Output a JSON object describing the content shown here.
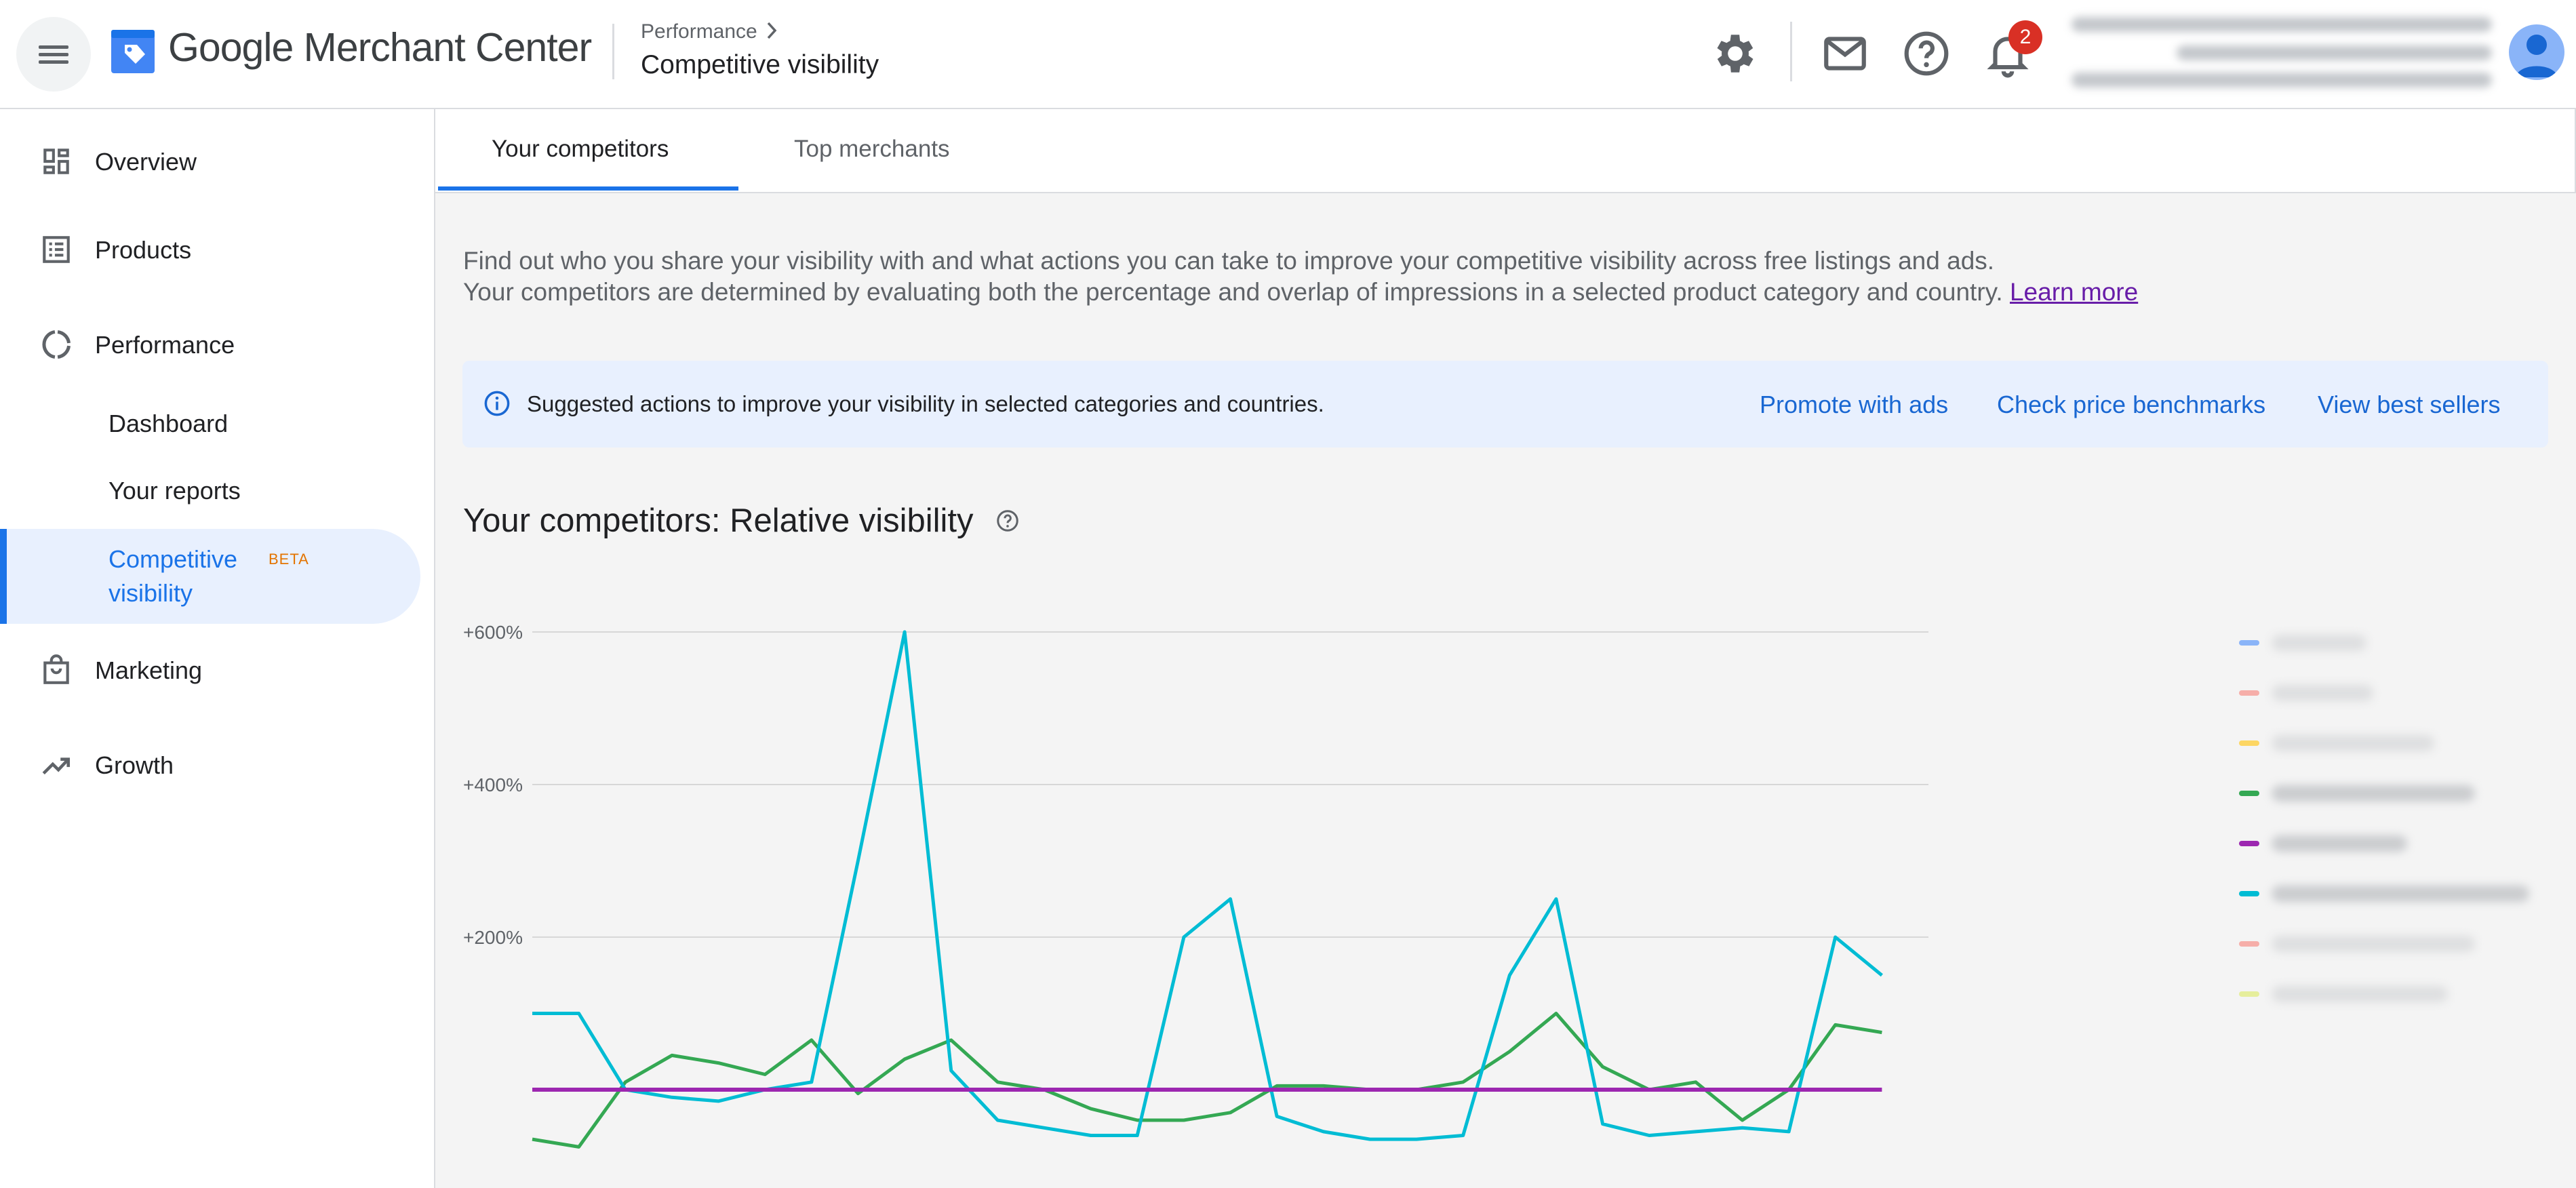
{
  "header": {
    "app_name_google": "Google",
    "app_name_rest": "Merchant Center",
    "breadcrumb_parent": "Performance",
    "page_title": "Competitive visibility",
    "notification_count": "2",
    "icons": [
      "settings-gear-icon",
      "mail-icon",
      "help-circle-icon",
      "bell-icon"
    ]
  },
  "sidebar": {
    "items": [
      {
        "label": "Overview",
        "icon": "dashboard-icon"
      },
      {
        "label": "Products",
        "icon": "list-icon"
      },
      {
        "label": "Performance",
        "icon": "donut-chart-icon"
      },
      {
        "label": "Marketing",
        "icon": "shopping-bag-icon"
      },
      {
        "label": "Growth",
        "icon": "trending-up-icon"
      }
    ],
    "performance_sub": [
      "Dashboard",
      "Your reports"
    ],
    "active_label": "Competitive visibility",
    "active_badge": "BETA",
    "accent": "#1a73e8",
    "active_bg": "#e8f0fe"
  },
  "tabs": [
    {
      "label": "Your competitors",
      "selected": true
    },
    {
      "label": "Top merchants",
      "selected": false
    }
  ],
  "intro": {
    "line1": "Find out who you share your visibility with and what actions you can take to improve your competitive visibility across free listings and ads.",
    "line2": "Your competitors are determined by evaluating both the percentage and overlap of impressions in a selected product category and country.",
    "learn_more": "Learn more"
  },
  "banner": {
    "text": "Suggested actions to improve your visibility in selected categories and countries.",
    "actions": [
      "Promote with ads",
      "Check price benchmarks",
      "View best sellers"
    ]
  },
  "chart_section": {
    "title": "Your competitors: Relative visibility"
  },
  "chart_data": {
    "type": "line",
    "title": "Your competitors: Relative visibility",
    "y_tick_labels": [
      "+600%",
      "+400%",
      "+200%"
    ],
    "y_ticks": [
      600,
      400,
      200
    ],
    "ylim": [
      -130,
      600
    ],
    "x": [
      0,
      1,
      2,
      3,
      4,
      5,
      6,
      7,
      8,
      9,
      10,
      11,
      12,
      13,
      14,
      15,
      16,
      17,
      18,
      19,
      20,
      21,
      22,
      23,
      24,
      25,
      26,
      27,
      28,
      29,
      30
    ],
    "grid": true,
    "legend_position": "right",
    "series": [
      {
        "color": "#00bcd4",
        "values": [
          100,
          100,
          0,
          -10,
          -15,
          0,
          10,
          300,
          600,
          25,
          -40,
          -50,
          -60,
          -60,
          200,
          250,
          -35,
          -55,
          -65,
          -65,
          -60,
          150,
          250,
          -45,
          -60,
          -55,
          -50,
          -55,
          200,
          150,
          null
        ]
      },
      {
        "color": "#34a853",
        "values": [
          -65,
          -75,
          10,
          45,
          35,
          20,
          65,
          -5,
          40,
          65,
          10,
          0,
          -25,
          -40,
          -40,
          -30,
          5,
          5,
          0,
          0,
          10,
          50,
          100,
          30,
          0,
          10,
          -40,
          0,
          85,
          75,
          null
        ]
      },
      {
        "color": "#9c27b0",
        "values": [
          0,
          0,
          0,
          0,
          0,
          0,
          0,
          0,
          0,
          0,
          0,
          0,
          0,
          0,
          0,
          0,
          0,
          0,
          0,
          0,
          0,
          0,
          0,
          0,
          0,
          0,
          0,
          0,
          0,
          0,
          null
        ]
      }
    ],
    "legend_swatch_colors": [
      "#8ab4f8",
      "#f6aea9",
      "#fdd663",
      "#34a853",
      "#9c27b0",
      "#00bcd4",
      "#f6aea9",
      "#e6ee9c"
    ]
  }
}
